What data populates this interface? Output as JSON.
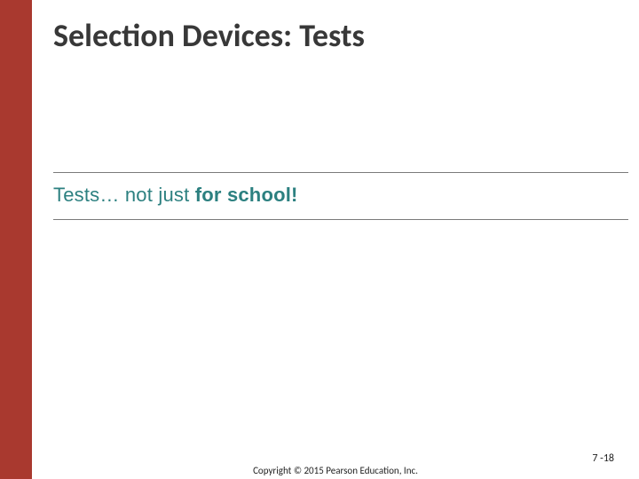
{
  "header": {
    "title": "Selection Devices: Tests"
  },
  "main": {
    "tagline_light": "Tests… not just ",
    "tagline_bold": "for school!"
  },
  "footer": {
    "copyright": "Copyright © 2015 Pearson Education, Inc.",
    "page_number": "7 -18"
  }
}
